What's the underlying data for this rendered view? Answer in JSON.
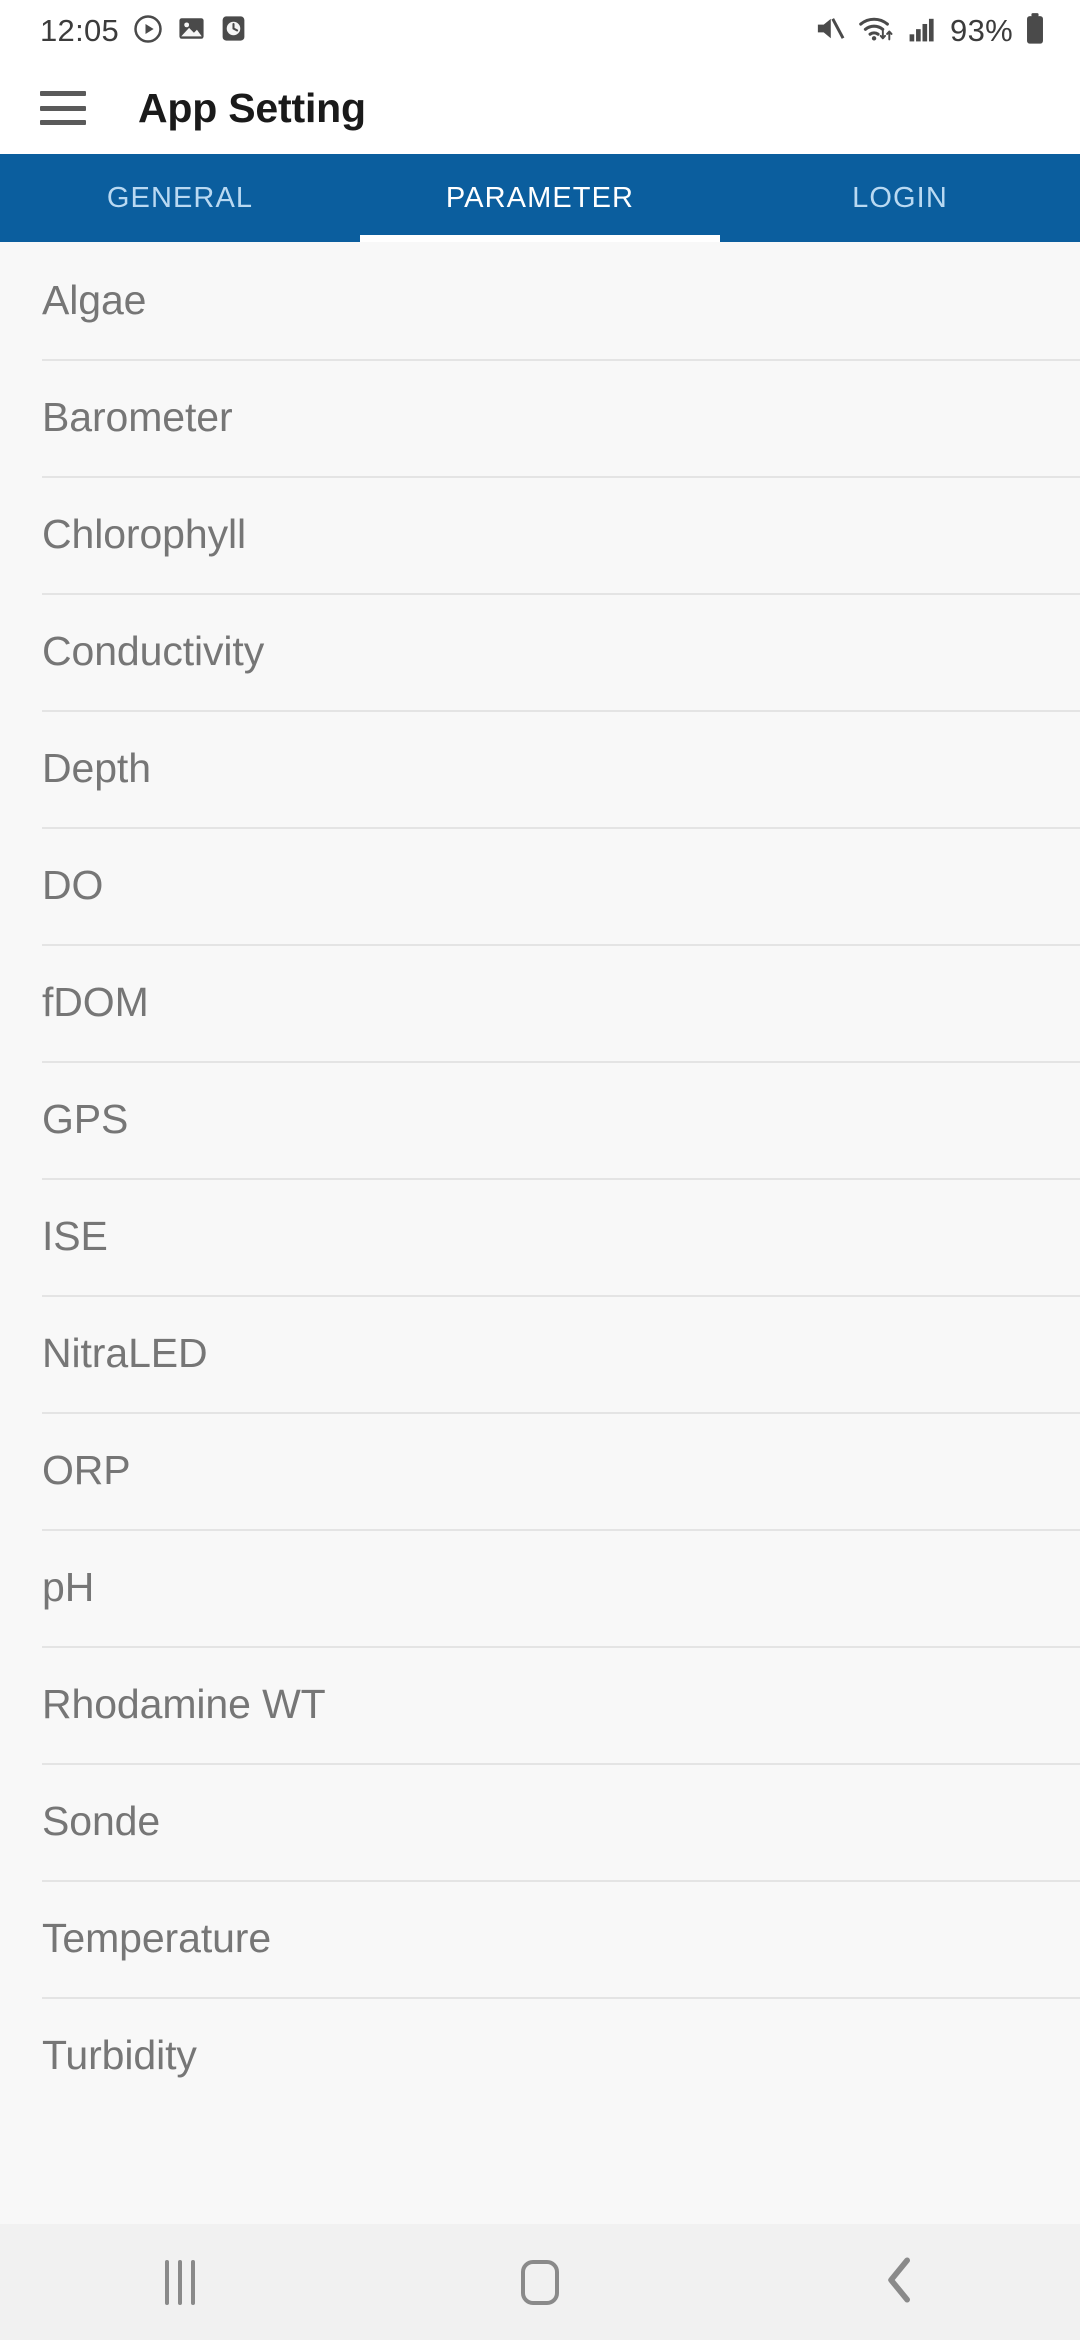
{
  "status_bar": {
    "time": "12:05",
    "left_icons": [
      "play-circle-icon",
      "image-icon",
      "clock-icon"
    ],
    "right_icons": [
      "mute-icon",
      "wifi-icon",
      "signal-icon"
    ],
    "battery_percent": "93%",
    "battery_icon": "battery-full-icon"
  },
  "app_bar": {
    "menu_icon": "hamburger-menu-icon",
    "title": "App Setting"
  },
  "tabs": {
    "active_index": 1,
    "items": [
      {
        "label": "GENERAL"
      },
      {
        "label": "PARAMETER"
      },
      {
        "label": "LOGIN"
      }
    ]
  },
  "parameter_list": {
    "items": [
      {
        "label": "Algae"
      },
      {
        "label": "Barometer"
      },
      {
        "label": "Chlorophyll"
      },
      {
        "label": "Conductivity"
      },
      {
        "label": "Depth"
      },
      {
        "label": "DO"
      },
      {
        "label": "fDOM"
      },
      {
        "label": "GPS"
      },
      {
        "label": "ISE"
      },
      {
        "label": "NitraLED"
      },
      {
        "label": "ORP"
      },
      {
        "label": "pH"
      },
      {
        "label": "Rhodamine WT"
      },
      {
        "label": "Sonde"
      },
      {
        "label": "Temperature"
      },
      {
        "label": "Turbidity"
      }
    ]
  },
  "nav_bar": {
    "recents_icon": "recents-icon",
    "home_icon": "home-icon",
    "back_icon": "back-chevron-icon"
  },
  "colors": {
    "tab_bar": "#0B5E9E",
    "tab_active_text": "#FFFFFF",
    "tab_inactive_text": "#B9D9F2",
    "list_background": "#F8F8F8",
    "list_text": "#767676",
    "divider": "#E4E4E4",
    "nav_background": "#F1F1F1",
    "title_text": "#1A1A1A"
  }
}
